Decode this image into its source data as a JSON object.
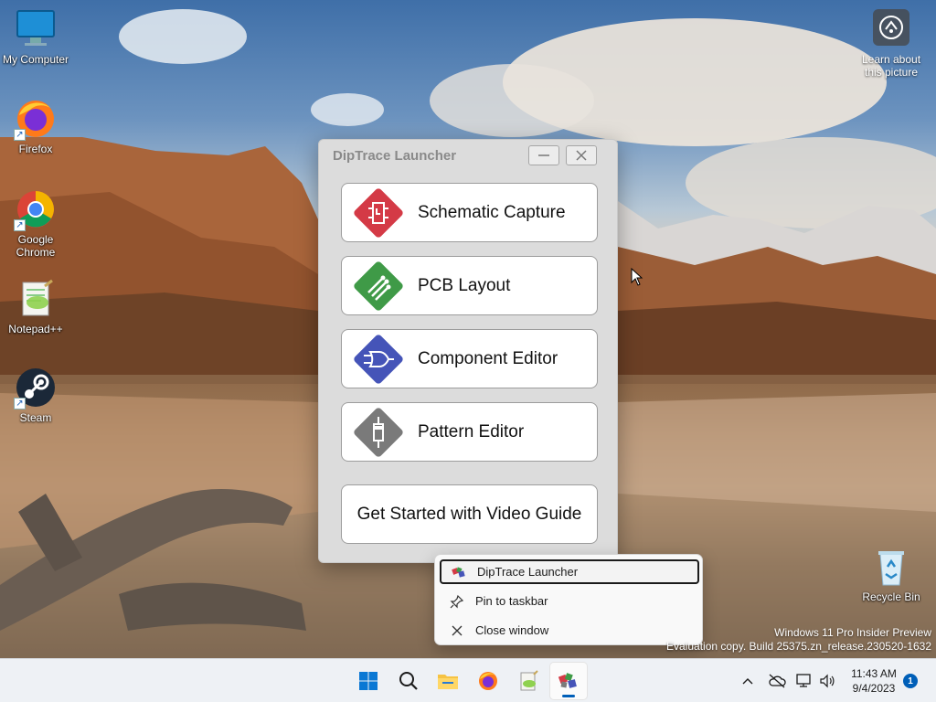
{
  "desktop": {
    "icons": [
      {
        "label": "My Computer",
        "icon": "monitor-icon"
      },
      {
        "label": "Firefox",
        "icon": "firefox-icon"
      },
      {
        "label": "Google Chrome",
        "icon": "chrome-icon"
      },
      {
        "label": "Notepad++",
        "icon": "notepadpp-icon"
      },
      {
        "label": "Steam",
        "icon": "steam-icon"
      },
      {
        "label": "Recycle Bin",
        "icon": "recycle-bin-icon"
      }
    ],
    "learn_about": "Learn about this picture",
    "shortcut_arrow": "↗"
  },
  "window": {
    "title": "DipTrace Launcher",
    "buttons": [
      {
        "label": "Schematic Capture",
        "icon": "schematic-icon",
        "color": "#d43a46"
      },
      {
        "label": "PCB Layout",
        "icon": "pcb-icon",
        "color": "#3f9a47"
      },
      {
        "label": "Component Editor",
        "icon": "component-icon",
        "color": "#4554b8"
      },
      {
        "label": "Pattern Editor",
        "icon": "pattern-icon",
        "color": "#7a7a7a"
      }
    ],
    "guide_label": "Get Started with Video Guide"
  },
  "context_menu": {
    "items": [
      {
        "label": "DipTrace Launcher",
        "icon": "diptrace-icon"
      },
      {
        "label": "Pin to taskbar",
        "icon": "pin-icon"
      },
      {
        "label": "Close window",
        "icon": "close-icon"
      }
    ]
  },
  "watermark": {
    "line1": "Windows 11 Pro Insider Preview",
    "line2": "Evaluation copy. Build 25375.zn_release.230520-1632"
  },
  "taskbar": {
    "apps": [
      "start-icon",
      "search-icon",
      "file-explorer-icon",
      "firefox-icon",
      "notepadpp-icon",
      "diptrace-icon"
    ],
    "time": "11:43 AM",
    "date": "9/4/2023",
    "notification_count": "1",
    "accent": "#005fb8"
  }
}
